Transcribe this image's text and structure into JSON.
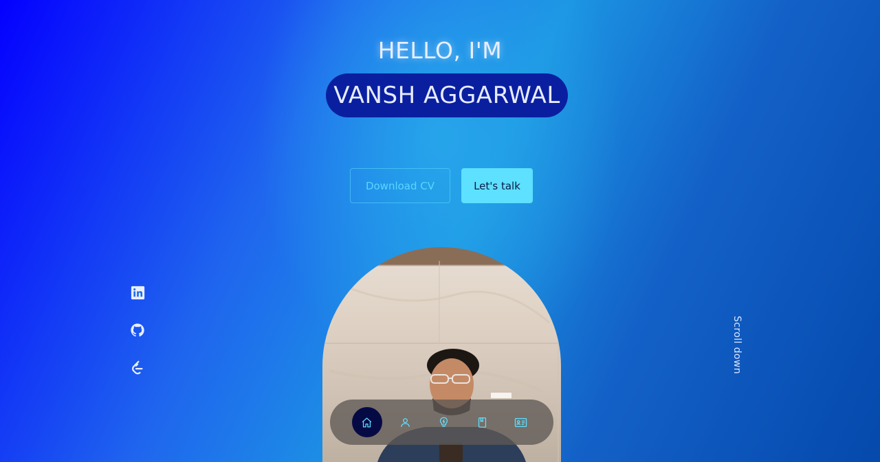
{
  "hero": {
    "greeting": "HELLO, I'M",
    "name": "VANSH AGGARWAL"
  },
  "actions": {
    "download_label": "Download CV",
    "talk_label": "Let's talk"
  },
  "socials": [
    {
      "icon": "linkedin-icon"
    },
    {
      "icon": "github-icon"
    },
    {
      "icon": "leetcode-icon"
    }
  ],
  "scroll": {
    "label": "Scroll down"
  },
  "nav": {
    "items": [
      {
        "icon": "home-icon",
        "active": true
      },
      {
        "icon": "user-icon",
        "active": false
      },
      {
        "icon": "lightbulb-icon",
        "active": false
      },
      {
        "icon": "book-icon",
        "active": false
      },
      {
        "icon": "contact-card-icon",
        "active": false
      }
    ]
  },
  "colors": {
    "accent": "#5ee0ff",
    "name_pill": "#0a1fa0",
    "nav_active": "#050a45"
  }
}
